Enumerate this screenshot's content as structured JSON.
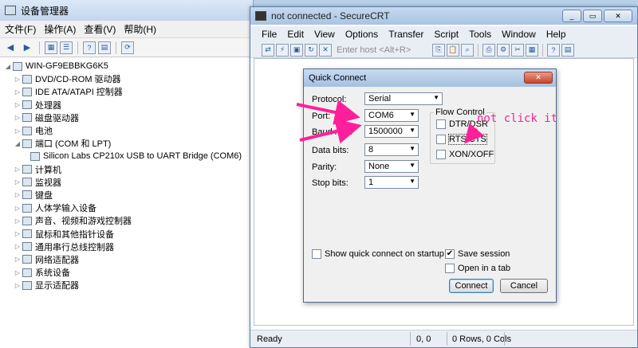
{
  "device_manager": {
    "title": "设备管理器",
    "menu": [
      "文件(F)",
      "操作(A)",
      "查看(V)",
      "帮助(H)"
    ],
    "tree": {
      "root": "WIN-GF9EBBKG6K5",
      "items": [
        {
          "label": "DVD/CD-ROM 驱动器",
          "icon": "dvd-drive-icon",
          "expanded": false
        },
        {
          "label": "IDE ATA/ATAPI 控制器",
          "icon": "ide-controller-icon",
          "expanded": false
        },
        {
          "label": "处理器",
          "icon": "processor-icon",
          "expanded": false
        },
        {
          "label": "磁盘驱动器",
          "icon": "disk-drive-icon",
          "expanded": false
        },
        {
          "label": "电池",
          "icon": "battery-icon",
          "expanded": false
        },
        {
          "label": "端口 (COM 和 LPT)",
          "icon": "port-icon",
          "expanded": true
        },
        {
          "label": "Silicon Labs CP210x USB to UART Bridge (COM6)",
          "icon": "port-device-icon",
          "child": true
        },
        {
          "label": "计算机",
          "icon": "computer-icon",
          "expanded": false
        },
        {
          "label": "监视器",
          "icon": "monitor-icon",
          "expanded": false
        },
        {
          "label": "键盘",
          "icon": "keyboard-icon",
          "expanded": false
        },
        {
          "label": "人体学输入设备",
          "icon": "hid-icon",
          "expanded": false
        },
        {
          "label": "声音、视频和游戏控制器",
          "icon": "sound-icon",
          "expanded": false
        },
        {
          "label": "鼠标和其他指针设备",
          "icon": "mouse-icon",
          "expanded": false
        },
        {
          "label": "通用串行总线控制器",
          "icon": "usb-icon",
          "expanded": false
        },
        {
          "label": "网络适配器",
          "icon": "network-adapter-icon",
          "expanded": false
        },
        {
          "label": "系统设备",
          "icon": "system-device-icon",
          "expanded": false
        },
        {
          "label": "显示适配器",
          "icon": "display-adapter-icon",
          "expanded": false
        }
      ]
    }
  },
  "securecrt": {
    "title": "not connected - SecureCRT",
    "menu": [
      "File",
      "Edit",
      "View",
      "Options",
      "Transfer",
      "Script",
      "Tools",
      "Window",
      "Help"
    ],
    "host_placeholder": "Enter host <Alt+R>",
    "status": {
      "text": "Ready",
      "position": "0, 0",
      "size": "0 Rows, 0 Cols"
    }
  },
  "quick_connect": {
    "title": "Quick Connect",
    "protocol": {
      "label": "Protocol:",
      "value": "Serial"
    },
    "port": {
      "label": "Port:",
      "value": "COM6"
    },
    "baud_rate": {
      "label": "Baud rate:",
      "value": "1500000"
    },
    "data_bits": {
      "label": "Data bits:",
      "value": "8"
    },
    "parity": {
      "label": "Parity:",
      "value": "None"
    },
    "stop_bits": {
      "label": "Stop bits:",
      "value": "1"
    },
    "flow_control": {
      "legend": "Flow Control",
      "dtr_dsr": {
        "label": "DTR/DSR",
        "checked": false
      },
      "rts_cts": {
        "label": "RTS/CTS",
        "checked": false
      },
      "xon_xoff": {
        "label": "XON/XOFF",
        "checked": false
      }
    },
    "show_on_startup": {
      "label": "Show quick connect on startup",
      "checked": false
    },
    "save_session": {
      "label": "Save session",
      "checked": true
    },
    "open_in_tab": {
      "label": "Open in a tab",
      "checked": false
    },
    "connect_label": "Connect",
    "cancel_label": "Cancel"
  },
  "annotation": {
    "text": "not click it",
    "color": "#ff1f9a"
  }
}
